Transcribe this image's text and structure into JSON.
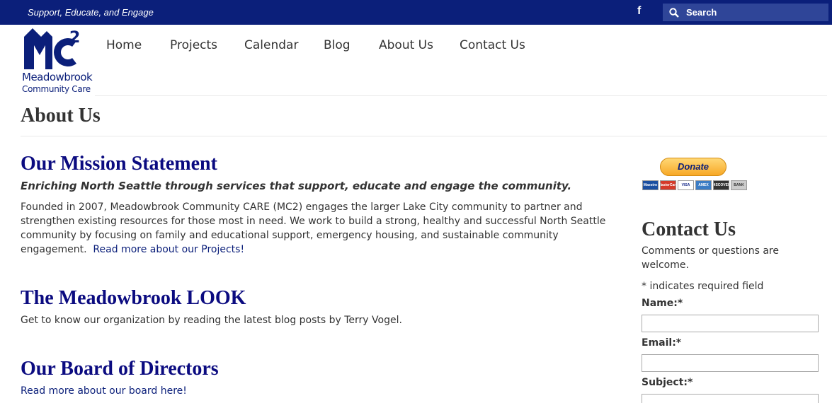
{
  "topbar": {
    "tagline": "Support, Educate, and Engage",
    "facebook_icon": "f",
    "search_placeholder": "Search"
  },
  "logo": {
    "line1": "Meadowbrook",
    "line2": "Community Care"
  },
  "nav": {
    "items": [
      "Home",
      "Projects",
      "Calendar",
      "Blog",
      "About Us",
      "Contact Us"
    ]
  },
  "page": {
    "title": "About Us"
  },
  "mission": {
    "heading": "Our Mission Statement",
    "motto": "Enriching North Seattle through services that support, educate and engage the community.",
    "lines": [
      "Founded in 2007, Meadowbrook Community CARE (MC2) engages the larger Lake City community to partner and",
      "strengthen existing resources for those most in need.  We work to build a strong, healthy and successful North Seattle",
      "community by focusing on family and educational support, emergency housing, and sustainable community",
      "engagement."
    ],
    "link": "Read more about our Projects!"
  },
  "look": {
    "heading": "The Meadowbrook LOOK",
    "text": "Get to know our organization by reading the latest blog posts by Terry Vogel."
  },
  "board": {
    "heading": "Our Board of Directors",
    "link": "Read more about our board here!"
  },
  "sidebar": {
    "donate_label": "Donate",
    "cards": [
      "Maestro",
      "MasterCard",
      "VISA",
      "AMEX",
      "DISCOVER",
      "BANK"
    ],
    "contact_title": "Contact Us",
    "contact_intro_1": "Comments or questions are",
    "contact_intro_2": "welcome.",
    "required_note": "* indicates required field",
    "fields": [
      "Name:*",
      "Email:*",
      "Subject:*"
    ]
  },
  "colors": {
    "topbar": "#0b1f7a",
    "heading": "#0b0b80"
  }
}
